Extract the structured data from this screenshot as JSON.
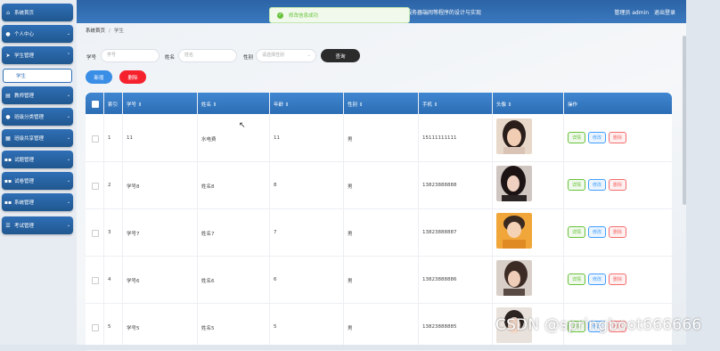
{
  "header": {
    "title": "服务器端闹等程序的设计与实现",
    "user": "管理员 admin",
    "logout": "退出登录"
  },
  "toast": {
    "message": "修改信息成功"
  },
  "breadcrumb": {
    "home": "系统首页",
    "sep": "/",
    "current": "学生"
  },
  "sidebar": {
    "items": [
      {
        "label": "系统首页",
        "icon": "home-icon"
      },
      {
        "label": "个人中心",
        "icon": "user-icon"
      },
      {
        "label": "学生管理",
        "icon": "send-icon"
      },
      {
        "label": "学生",
        "icon": "",
        "sub": true
      },
      {
        "label": "教师管理",
        "icon": "doc-icon"
      },
      {
        "label": "班级分类管理",
        "icon": "user-icon"
      },
      {
        "label": "班级共享管理",
        "icon": "bank-icon"
      },
      {
        "label": "试题管理",
        "icon": "grid-icon"
      },
      {
        "label": "试卷管理",
        "icon": "grid-icon"
      },
      {
        "label": "系统管理",
        "icon": "grid-icon"
      },
      {
        "label": "考试管理",
        "icon": "list-icon"
      }
    ]
  },
  "search": {
    "student_no_label": "学号",
    "student_no_placeholder": "学号",
    "name_label": "姓名",
    "name_placeholder": "姓名",
    "gender_label": "性别",
    "gender_placeholder": "请选择性别",
    "query_button": "查询"
  },
  "actions": {
    "add": "新增",
    "delete": "删除"
  },
  "table": {
    "columns": [
      "索引",
      "学号 ⇕",
      "姓名 ⇕",
      "年龄 ⇕",
      "性别 ⇕",
      "手机 ⇕",
      "头像 ⇕",
      "操作"
    ],
    "ops": {
      "detail": "详情",
      "edit": "修改",
      "delete": "删除"
    },
    "rows": [
      {
        "index": "1",
        "student_no": "11",
        "name": "水电费",
        "age": "11",
        "gender": "男",
        "phone": "15111111111"
      },
      {
        "index": "2",
        "student_no": "学号8",
        "name": "姓名8",
        "age": "8",
        "gender": "男",
        "phone": "13823888888"
      },
      {
        "index": "3",
        "student_no": "学号7",
        "name": "姓名7",
        "age": "7",
        "gender": "男",
        "phone": "13823888887"
      },
      {
        "index": "4",
        "student_no": "学号6",
        "name": "姓名6",
        "age": "6",
        "gender": "男",
        "phone": "13823888886"
      },
      {
        "index": "5",
        "student_no": "学号5",
        "name": "姓名5",
        "age": "5",
        "gender": "男",
        "phone": "13823888885"
      }
    ]
  },
  "watermark": "CSDN @springboot666666",
  "colors": {
    "primary": "#2f6fb6",
    "danger": "#f5222d",
    "success": "#67c23a",
    "header": "#2c64a6"
  }
}
